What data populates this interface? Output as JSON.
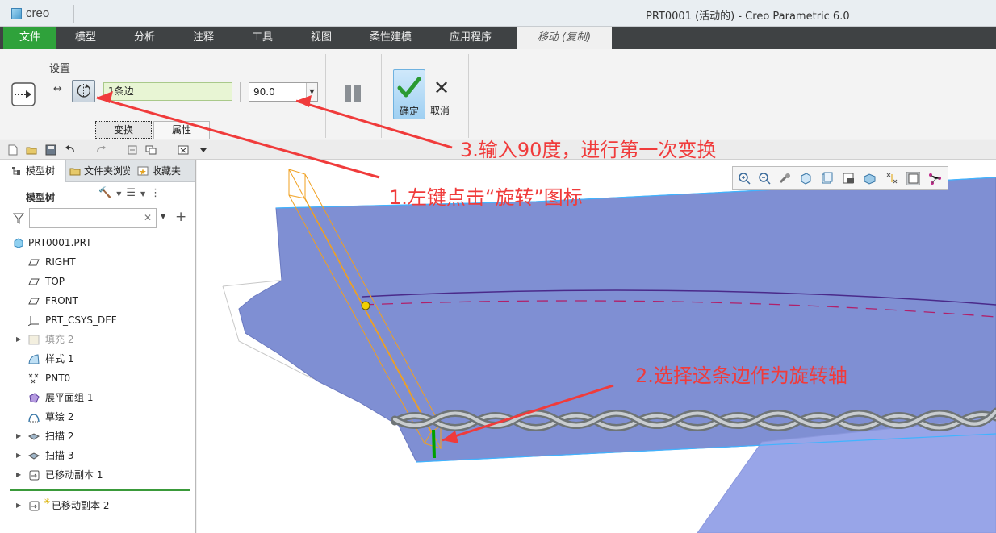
{
  "window": {
    "logo_text": "creo",
    "title": "PRT0001 (活动的) - Creo Parametric 6.0"
  },
  "ribbon_tabs": [
    {
      "label": "文件"
    },
    {
      "label": "模型"
    },
    {
      "label": "分析"
    },
    {
      "label": "注释"
    },
    {
      "label": "工具"
    },
    {
      "label": "视图"
    },
    {
      "label": "柔性建模"
    },
    {
      "label": "应用程序"
    },
    {
      "label": "移动 (复制)"
    }
  ],
  "ribbon": {
    "group_label": "设置",
    "edge_reference": "1条边",
    "angle_value": "90.0",
    "ok_label": "确定",
    "cancel_label": "取消",
    "subtabs": [
      {
        "label": "变换"
      },
      {
        "label": "属性"
      }
    ]
  },
  "left_panel": {
    "tabs": [
      {
        "label": "模型树"
      },
      {
        "label": "文件夹浏览器"
      },
      {
        "label": "收藏夹"
      }
    ],
    "tree_header": "模型树",
    "filter_placeholder": "",
    "tree_items": [
      {
        "label": "PRT0001.PRT",
        "icon": "part-icon"
      },
      {
        "label": "RIGHT",
        "icon": "datum-plane-icon"
      },
      {
        "label": "TOP",
        "icon": "datum-plane-icon"
      },
      {
        "label": "FRONT",
        "icon": "datum-plane-icon"
      },
      {
        "label": "PRT_CSYS_DEF",
        "icon": "csys-icon"
      },
      {
        "label": "填充 2",
        "icon": "fill-icon"
      },
      {
        "label": "样式 1",
        "icon": "style-icon"
      },
      {
        "label": "PNT0",
        "icon": "datum-point-icon"
      },
      {
        "label": "展平面组 1",
        "icon": "flatten-quilt-icon"
      },
      {
        "label": "草绘 2",
        "icon": "sketch-icon"
      },
      {
        "label": "扫描 2",
        "icon": "sweep-icon"
      },
      {
        "label": "扫描 3",
        "icon": "sweep-icon"
      },
      {
        "label": "已移动副本 1",
        "icon": "moved-copy-icon"
      },
      {
        "label": "已移动副本 2",
        "icon": "moved-copy-icon"
      }
    ]
  },
  "annotations": {
    "step1": "1.左键点击“旋转”图标",
    "step2": "2.选择这条边作为旋转轴",
    "step3": "3.输入90度，进行第一次变换"
  },
  "colors": {
    "file_tab": "#2fa23b",
    "annotation": "#f03b3b",
    "surface": "#7f8fd3",
    "edge_selected": "#00a000"
  }
}
